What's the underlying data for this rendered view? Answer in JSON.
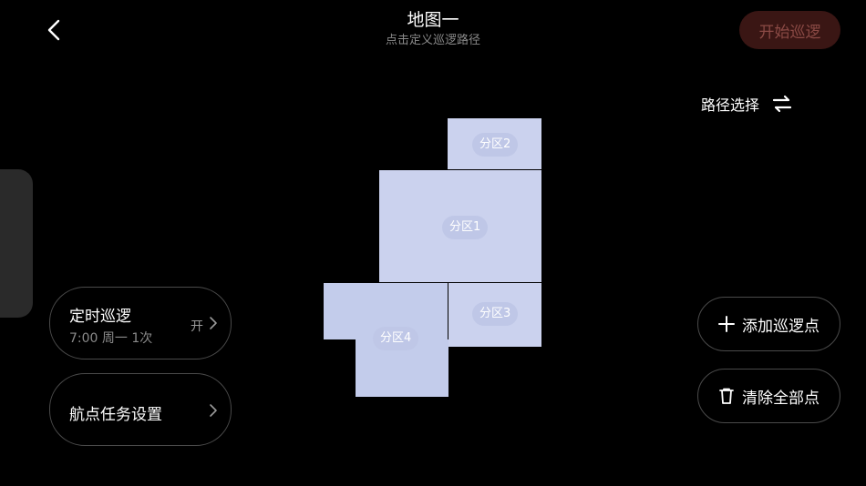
{
  "header": {
    "title": "地图一",
    "subtitle": "点击定义巡逻路径",
    "start_button": "开始巡逻"
  },
  "route_select": {
    "label": "路径选择",
    "icon": "swap-icon"
  },
  "schedule_card": {
    "title": "定时巡逻",
    "subtitle": "7:00 周一 1次",
    "status": "开"
  },
  "waypoint_card": {
    "title": "航点任务设置"
  },
  "actions": {
    "add_label": "添加巡逻点",
    "clear_label": "清除全部点"
  },
  "map": {
    "zones": [
      {
        "id": "zone-2",
        "label": "分区2"
      },
      {
        "id": "zone-1",
        "label": "分区1"
      },
      {
        "id": "zone-3",
        "label": "分区3"
      },
      {
        "id": "zone-4",
        "label": "分区4"
      }
    ]
  },
  "colors": {
    "background": "#000000",
    "zone_fill": "#cbd2ee",
    "zone4_fill": "#c3cceb",
    "start_button_bg": "#3a1614",
    "start_button_text": "#8b4a45",
    "border": "#4a4a4a"
  }
}
